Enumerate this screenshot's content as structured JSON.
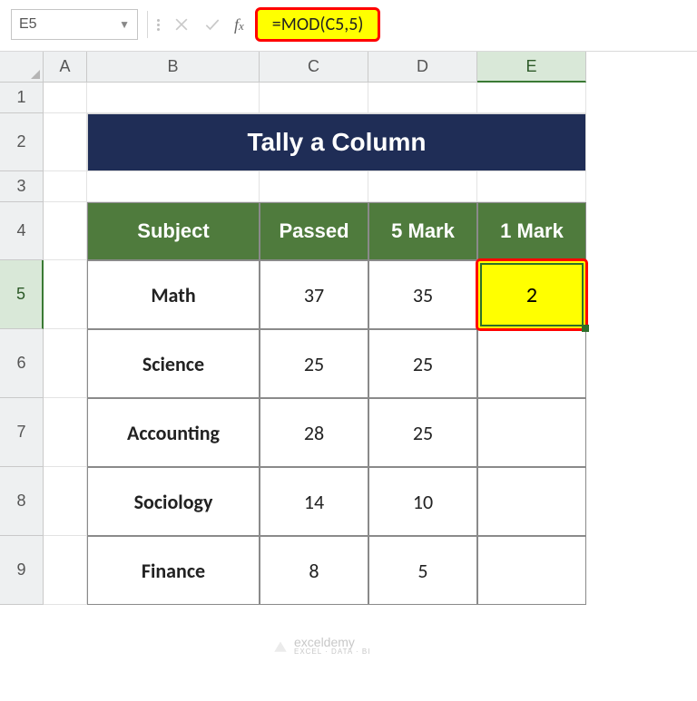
{
  "nameBox": {
    "value": "E5"
  },
  "formulaBar": {
    "formula": "=MOD(C5,5)"
  },
  "columnHeaders": [
    "A",
    "B",
    "C",
    "D",
    "E"
  ],
  "rowHeaders": [
    "1",
    "2",
    "3",
    "4",
    "5",
    "6",
    "7",
    "8",
    "9"
  ],
  "title": "Tally a Column",
  "table": {
    "headers": {
      "subject": "Subject",
      "passed": "Passed",
      "mark5": "5 Mark",
      "mark1": "1 Mark"
    },
    "rows": [
      {
        "subject": "Math",
        "passed": "37",
        "mark5": "35",
        "mark1": "2"
      },
      {
        "subject": "Science",
        "passed": "25",
        "mark5": "25",
        "mark1": ""
      },
      {
        "subject": "Accounting",
        "passed": "28",
        "mark5": "25",
        "mark1": ""
      },
      {
        "subject": "Sociology",
        "passed": "14",
        "mark5": "10",
        "mark1": ""
      },
      {
        "subject": "Finance",
        "passed": "8",
        "mark5": "5",
        "mark1": ""
      }
    ]
  },
  "watermark": {
    "brand": "exceldemy",
    "tagline": "EXCEL · DATA · BI"
  },
  "chart_data": {
    "type": "table",
    "title": "Tally a Column",
    "columns": [
      "Subject",
      "Passed",
      "5 Mark",
      "1 Mark"
    ],
    "rows": [
      [
        "Math",
        37,
        35,
        2
      ],
      [
        "Science",
        25,
        25,
        null
      ],
      [
        "Accounting",
        28,
        25,
        null
      ],
      [
        "Sociology",
        14,
        10,
        null
      ],
      [
        "Finance",
        8,
        5,
        null
      ]
    ]
  }
}
